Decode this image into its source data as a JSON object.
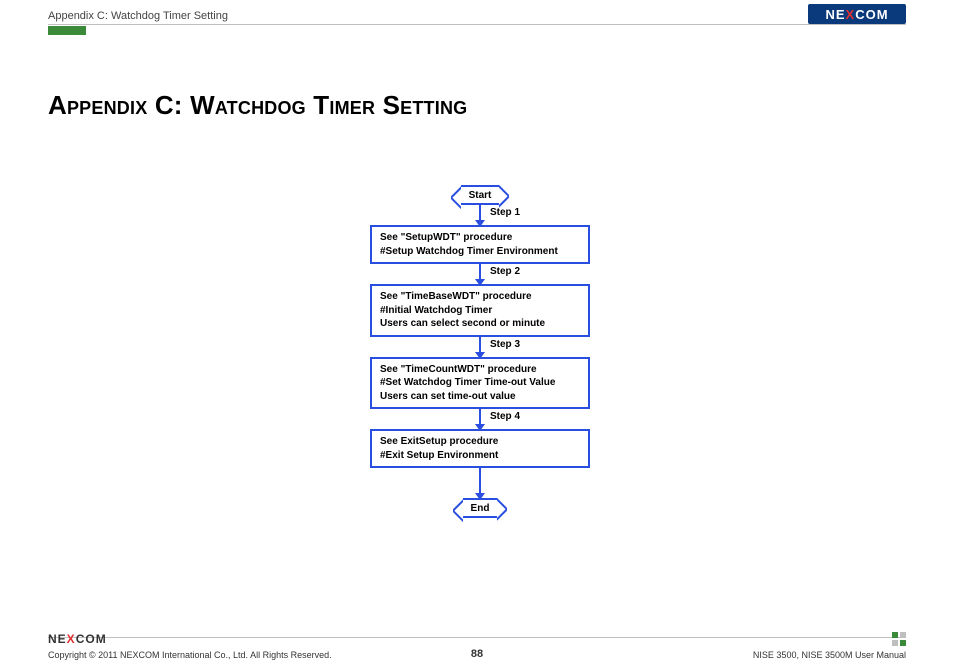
{
  "header": {
    "breadcrumb": "Appendix C: Watchdog Timer Setting",
    "logo_text_pre": "NE",
    "logo_text_x": "X",
    "logo_text_post": "COM"
  },
  "title": "Appendix C: Watchdog Timer Setting",
  "flow": {
    "start": "Start",
    "end": "End",
    "step1_label": "Step 1",
    "step2_label": "Step 2",
    "step3_label": "Step 3",
    "step4_label": "Step 4",
    "box1_l1": "See \"SetupWDT\" procedure",
    "box1_l2": "#Setup Watchdog Timer Environment",
    "box2_l1": "See \"TimeBaseWDT\" procedure",
    "box2_l2": "#Initial Watchdog Timer",
    "box2_l3": "Users can select second or minute",
    "box3_l1": "See \"TimeCountWDT\" procedure",
    "box3_l2": "#Set Watchdog Timer Time-out Value",
    "box3_l3": "Users can set time-out value",
    "box4_l1": "See ExitSetup procedure",
    "box4_l2": "#Exit Setup Environment"
  },
  "footer": {
    "logo_pre": "NE",
    "logo_x": "X",
    "logo_post": "COM",
    "copyright": "Copyright © 2011 NEXCOM International Co., Ltd. All Rights Reserved.",
    "page_number": "88",
    "manual": "NISE 3500, NISE 3500M User Manual"
  }
}
